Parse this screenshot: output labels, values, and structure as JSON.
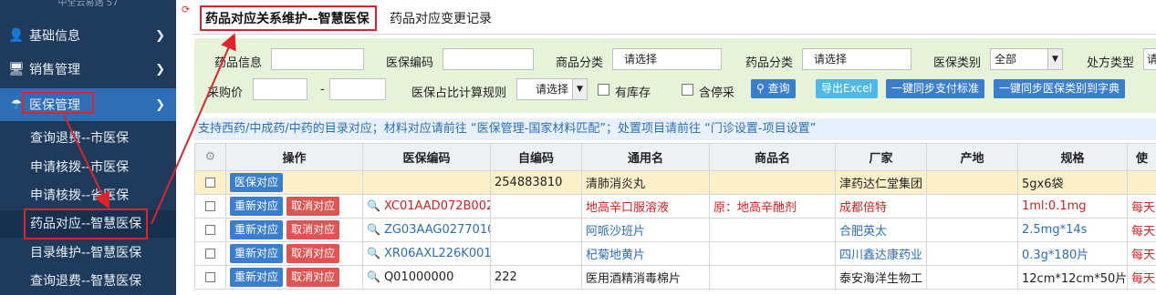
{
  "sidebar": {
    "top_text": "中全云易遇 57",
    "sections": [
      {
        "label": "基础信息",
        "icon": "user-icon"
      },
      {
        "label": "销售管理",
        "icon": "monitor-icon"
      },
      {
        "label": "医保管理",
        "icon": "umbrella-icon"
      }
    ],
    "sub_items": [
      "查询退费--市医保",
      "申请核拨--市医保",
      "申请核拨--省医保",
      "药品对应--智慧医保",
      "目录维护--智慧医保",
      "查询退费--智慧医保"
    ]
  },
  "tabs": [
    "药品对应关系维护--智慧医保",
    "药品对应变更记录"
  ],
  "filters": {
    "drug_info_label": "药品信息",
    "insurance_code_label": "医保编码",
    "product_category_label": "商品分类",
    "product_category_value": "请选择",
    "drug_category_label": "药品分类",
    "drug_category_value": "请选择",
    "insurance_type_label": "医保类别",
    "insurance_type_value": "全部",
    "prescription_type_label": "处方类型",
    "prescription_type_value": "请",
    "purchase_price_label": "采购价",
    "price_dash": "-",
    "ratio_rule_label": "医保占比计算规则",
    "ratio_rule_value": "请选择",
    "in_stock_label": "有库存",
    "include_stopped_label": "含停采",
    "query_button": "查询",
    "export_button": "导出Excel",
    "sync_payment_button": "一键同步支付标准",
    "sync_category_button": "一键同步医保类别到字典"
  },
  "notice": "支持西药/中成药/中药的目录对应；材料对应请前往 “医保管理-国家材料匹配”；处置项目请前往 “门诊设置-项目设置”",
  "table": {
    "headers": [
      "操作",
      "医保编码",
      "自编码",
      "通用名",
      "商品名",
      "厂家",
      "产地",
      "规格",
      "使"
    ],
    "rows": [
      {
        "buttons": [
          "医保对应"
        ],
        "code": "",
        "self_code": "254883810",
        "generic": "清肺消炎丸",
        "trade": "",
        "maker": "津药达仁堂集团",
        "origin": "",
        "spec": "5gx6袋",
        "use": "",
        "style": "highlight"
      },
      {
        "buttons": [
          "重新对应",
          "取消对应"
        ],
        "code": "XC01AAD072B002",
        "self_code": "",
        "generic": "地高辛口服溶液",
        "trade": "原：地高辛酏剂",
        "maker": "成都倍特",
        "origin": "",
        "spec": "1ml:0.1mg",
        "use": "每天",
        "style": "red"
      },
      {
        "buttons": [
          "重新对应",
          "取消对应"
        ],
        "code": "ZG03AAG0277010",
        "self_code": "",
        "generic": "阿哌沙班片",
        "trade": "",
        "maker": "合肥英太",
        "origin": "",
        "spec": "2.5mg*14s",
        "use": "每天",
        "style": "blue"
      },
      {
        "buttons": [
          "重新对应",
          "取消对应"
        ],
        "code": "XR06AXL226K001",
        "self_code": "",
        "generic": "杞菊地黄片",
        "trade": "",
        "maker": "四川鑫达康药业",
        "origin": "",
        "spec": "0.3g*180片",
        "use": "每天",
        "style": "blue"
      },
      {
        "buttons": [
          "重新对应",
          "取消对应"
        ],
        "code": "Q01000000",
        "self_code": "222",
        "generic": "医用酒精消毒棉片",
        "trade": "",
        "maker": "泰安海洋生物工",
        "origin": "",
        "spec": "12cm*12cm*50片",
        "use": "每天",
        "style": "plain"
      }
    ]
  },
  "colors": {
    "sidebar": "#1f3b5c",
    "active": "#2d6eb5",
    "annotation": "#e0232b",
    "filter_bg": "#e6f3d9"
  }
}
